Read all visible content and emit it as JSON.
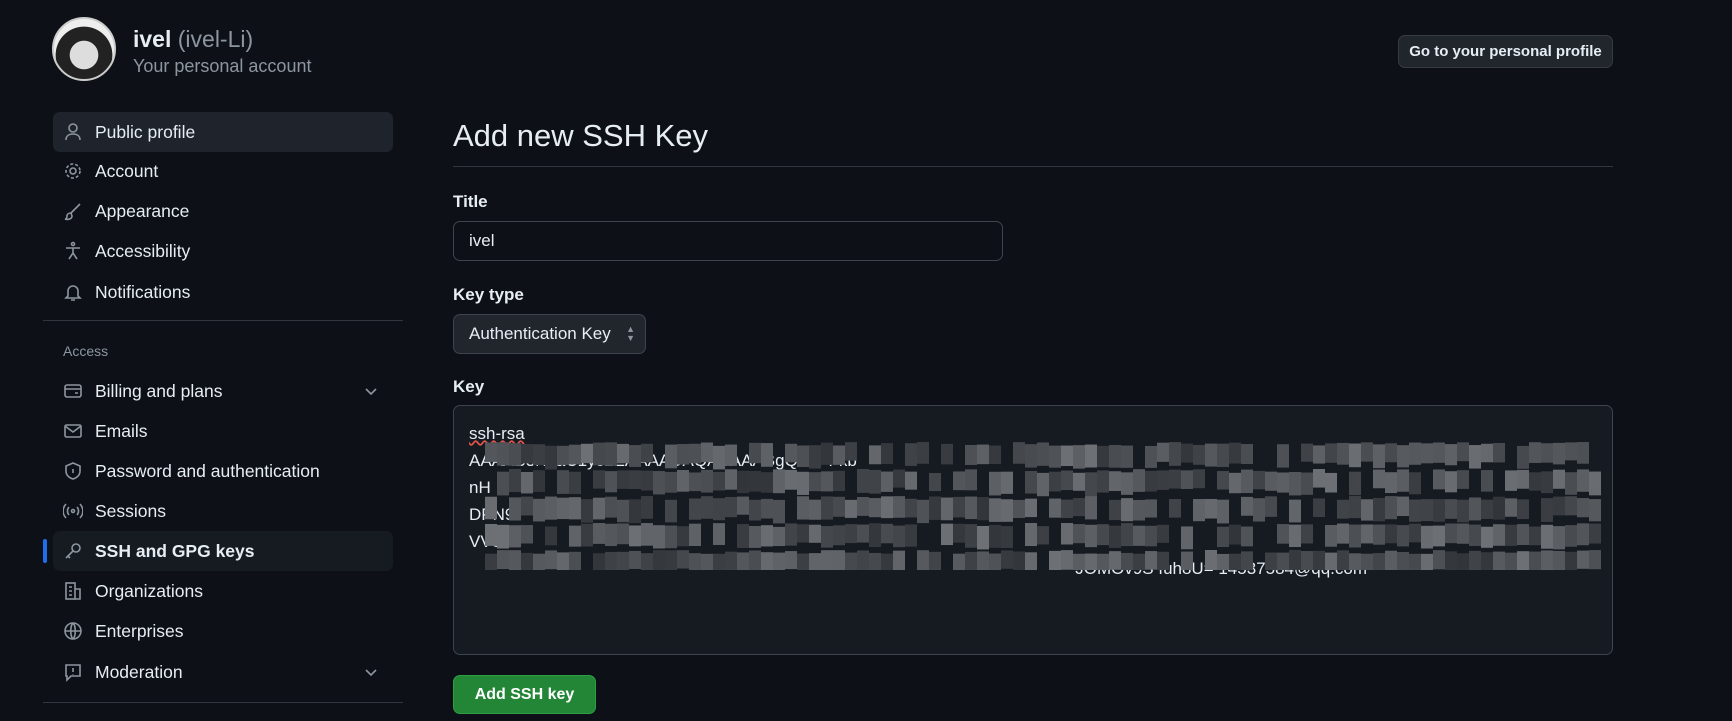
{
  "account": {
    "name": "ivel",
    "login": "(ivel-Li)",
    "subtitle": "Your personal account",
    "profile_button": "Go to your personal profile"
  },
  "sidebar": {
    "items": [
      {
        "label": "Public profile",
        "icon": "person-icon"
      },
      {
        "label": "Account",
        "icon": "gear-icon"
      },
      {
        "label": "Appearance",
        "icon": "paintbrush-icon"
      },
      {
        "label": "Accessibility",
        "icon": "accessibility-icon"
      },
      {
        "label": "Notifications",
        "icon": "bell-icon"
      }
    ],
    "section_label": "Access",
    "access_items": [
      {
        "label": "Billing and plans",
        "icon": "credit-card-icon"
      },
      {
        "label": "Emails",
        "icon": "mail-icon"
      },
      {
        "label": "Password and authentication",
        "icon": "shield-icon"
      },
      {
        "label": "Sessions",
        "icon": "broadcast-icon"
      },
      {
        "label": "SSH and GPG keys",
        "icon": "key-icon"
      },
      {
        "label": "Organizations",
        "icon": "organization-icon"
      },
      {
        "label": "Enterprises",
        "icon": "globe-icon"
      },
      {
        "label": "Moderation",
        "icon": "report-icon"
      }
    ]
  },
  "main": {
    "title": "Add new SSH Key",
    "title_label": "Title",
    "title_value": "ivel",
    "key_type_label": "Key type",
    "key_type_value": "Authentication Key",
    "key_label": "Key",
    "key_lines": [
      "ssh-rsa",
      "AAAAB3NzaC1yc2EAAAADAQABAAABgQDk+Fkb",
      "nH",
      "DPN9",
      "VVSIX",
      "JOMOv9S  fuh8U= 14537584@qq.com"
    ],
    "submit": "Add SSH key"
  }
}
